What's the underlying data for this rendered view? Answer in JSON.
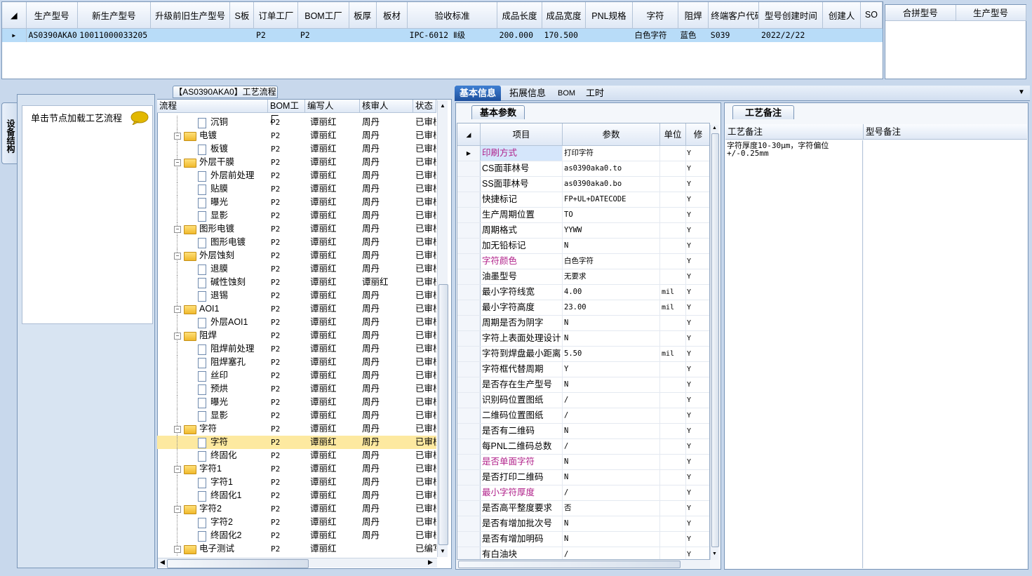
{
  "top_grid": {
    "columns": [
      "生产型号",
      "新生产型号",
      "升级前旧生产型号",
      "S板",
      "订单工厂",
      "BOM工厂",
      "板厚",
      "板材",
      "验收标准",
      "成品长度",
      "成品宽度",
      "PNL规格",
      "字符",
      "阻焊",
      "终端客户代码",
      "型号创建时间",
      "创建人",
      "SO"
    ],
    "rows": [
      [
        "AS0390AKA0",
        "10011000033205",
        "",
        "",
        "P2",
        "P2",
        "",
        "",
        "IPC-6012 Ⅱ级",
        "200.000",
        "170.500",
        "",
        "白色字符",
        "蓝色",
        "S039",
        "2022/2/22",
        "",
        ""
      ]
    ]
  },
  "merge_grid": {
    "columns": [
      "合拼型号",
      "生产型号"
    ]
  },
  "device_panel": {
    "tab_label": "设备结构",
    "hint": "单击节点加载工艺流程"
  },
  "flow": {
    "title": "【AS0390AKA0】工艺流程",
    "columns": [
      "流程",
      "BOM工厂",
      "编写人",
      "核审人",
      "状态"
    ],
    "rows": [
      {
        "name": "沉铜",
        "level": 1,
        "bom": "P2",
        "writer": "谭丽红",
        "reviewer": "周丹",
        "status": "已审核"
      },
      {
        "name": "电镀",
        "level": 0,
        "bom": "P2",
        "writer": "谭丽红",
        "reviewer": "周丹",
        "status": "已审核"
      },
      {
        "name": "板镀",
        "level": 1,
        "bom": "P2",
        "writer": "谭丽红",
        "reviewer": "周丹",
        "status": "已审核"
      },
      {
        "name": "外层干膜",
        "level": 0,
        "bom": "P2",
        "writer": "谭丽红",
        "reviewer": "周丹",
        "status": "已审核"
      },
      {
        "name": "外层前处理",
        "level": 1,
        "bom": "P2",
        "writer": "谭丽红",
        "reviewer": "周丹",
        "status": "已审核"
      },
      {
        "name": "贴膜",
        "level": 1,
        "bom": "P2",
        "writer": "谭丽红",
        "reviewer": "周丹",
        "status": "已审核"
      },
      {
        "name": "曝光",
        "level": 1,
        "bom": "P2",
        "writer": "谭丽红",
        "reviewer": "周丹",
        "status": "已审核"
      },
      {
        "name": "显影",
        "level": 1,
        "bom": "P2",
        "writer": "谭丽红",
        "reviewer": "周丹",
        "status": "已审核"
      },
      {
        "name": "图形电镀",
        "level": 0,
        "bom": "P2",
        "writer": "谭丽红",
        "reviewer": "周丹",
        "status": "已审核"
      },
      {
        "name": "图形电镀",
        "level": 1,
        "bom": "P2",
        "writer": "谭丽红",
        "reviewer": "周丹",
        "status": "已审核"
      },
      {
        "name": "外层蚀刻",
        "level": 0,
        "bom": "P2",
        "writer": "谭丽红",
        "reviewer": "周丹",
        "status": "已审核"
      },
      {
        "name": "退膜",
        "level": 1,
        "bom": "P2",
        "writer": "谭丽红",
        "reviewer": "周丹",
        "status": "已审核"
      },
      {
        "name": "碱性蚀刻",
        "level": 1,
        "bom": "P2",
        "writer": "谭丽红",
        "reviewer": "谭丽红",
        "status": "已审核"
      },
      {
        "name": "退锡",
        "level": 1,
        "bom": "P2",
        "writer": "谭丽红",
        "reviewer": "周丹",
        "status": "已审核"
      },
      {
        "name": "AOI1",
        "level": 0,
        "bom": "P2",
        "writer": "谭丽红",
        "reviewer": "周丹",
        "status": "已审核"
      },
      {
        "name": "外层AOI1",
        "level": 1,
        "bom": "P2",
        "writer": "谭丽红",
        "reviewer": "周丹",
        "status": "已审核"
      },
      {
        "name": "阻焊",
        "level": 0,
        "bom": "P2",
        "writer": "谭丽红",
        "reviewer": "周丹",
        "status": "已审核"
      },
      {
        "name": "阻焊前处理",
        "level": 1,
        "bom": "P2",
        "writer": "谭丽红",
        "reviewer": "周丹",
        "status": "已审核"
      },
      {
        "name": "阻焊塞孔",
        "level": 1,
        "bom": "P2",
        "writer": "谭丽红",
        "reviewer": "周丹",
        "status": "已审核"
      },
      {
        "name": "丝印",
        "level": 1,
        "bom": "P2",
        "writer": "谭丽红",
        "reviewer": "周丹",
        "status": "已审核"
      },
      {
        "name": "预烘",
        "level": 1,
        "bom": "P2",
        "writer": "谭丽红",
        "reviewer": "周丹",
        "status": "已审核"
      },
      {
        "name": "曝光",
        "level": 1,
        "bom": "P2",
        "writer": "谭丽红",
        "reviewer": "周丹",
        "status": "已审核"
      },
      {
        "name": "显影",
        "level": 1,
        "bom": "P2",
        "writer": "谭丽红",
        "reviewer": "周丹",
        "status": "已审核"
      },
      {
        "name": "字符",
        "level": 0,
        "bom": "P2",
        "writer": "谭丽红",
        "reviewer": "周丹",
        "status": "已审核"
      },
      {
        "name": "字符",
        "level": 1,
        "bom": "P2",
        "writer": "谭丽红",
        "reviewer": "周丹",
        "status": "已审核",
        "selected": true
      },
      {
        "name": "终固化",
        "level": 1,
        "bom": "P2",
        "writer": "谭丽红",
        "reviewer": "周丹",
        "status": "已审核"
      },
      {
        "name": "字符1",
        "level": 0,
        "bom": "P2",
        "writer": "谭丽红",
        "reviewer": "周丹",
        "status": "已审核"
      },
      {
        "name": "字符1",
        "level": 1,
        "bom": "P2",
        "writer": "谭丽红",
        "reviewer": "周丹",
        "status": "已审核"
      },
      {
        "name": "终固化1",
        "level": 1,
        "bom": "P2",
        "writer": "谭丽红",
        "reviewer": "周丹",
        "status": "已审核"
      },
      {
        "name": "字符2",
        "level": 0,
        "bom": "P2",
        "writer": "谭丽红",
        "reviewer": "周丹",
        "status": "已审核"
      },
      {
        "name": "字符2",
        "level": 1,
        "bom": "P2",
        "writer": "谭丽红",
        "reviewer": "周丹",
        "status": "已审核"
      },
      {
        "name": "终固化2",
        "level": 1,
        "bom": "P2",
        "writer": "谭丽红",
        "reviewer": "周丹",
        "status": "已审核"
      },
      {
        "name": "电子测试",
        "level": 0,
        "bom": "P2",
        "writer": "谭丽红",
        "reviewer": "",
        "status": "已编写"
      }
    ]
  },
  "right_tabs": [
    "基本信息",
    "拓展信息",
    "BOM",
    "工时"
  ],
  "basic": {
    "title": "基本参数",
    "columns": [
      "项目",
      "参数",
      "单位",
      "修"
    ],
    "rows": [
      {
        "item": "印刷方式",
        "value": "打印字符",
        "unit": "",
        "mod": "Y",
        "hl": true,
        "current": true
      },
      {
        "item": "CS面菲林号",
        "value": "as0390aka0.to",
        "unit": "",
        "mod": "Y"
      },
      {
        "item": "SS面菲林号",
        "value": "as0390aka0.bo",
        "unit": "",
        "mod": "Y"
      },
      {
        "item": "快捷标记",
        "value": "FP+UL+DATECODE",
        "unit": "",
        "mod": "Y"
      },
      {
        "item": "生产周期位置",
        "value": "TO",
        "unit": "",
        "mod": "Y"
      },
      {
        "item": "周期格式",
        "value": "YYWW",
        "unit": "",
        "mod": "Y"
      },
      {
        "item": "加无铅标记",
        "value": "N",
        "unit": "",
        "mod": "Y"
      },
      {
        "item": "字符颜色",
        "value": "白色字符",
        "unit": "",
        "mod": "Y",
        "hl": true
      },
      {
        "item": "油墨型号",
        "value": "无要求",
        "unit": "",
        "mod": "Y"
      },
      {
        "item": "最小字符线宽",
        "value": "4.00",
        "unit": "mil",
        "mod": "Y"
      },
      {
        "item": "最小字符高度",
        "value": "23.00",
        "unit": "mil",
        "mod": "Y"
      },
      {
        "item": "周期是否为阴字",
        "value": "N",
        "unit": "",
        "mod": "Y"
      },
      {
        "item": "字符上表面处理设计",
        "value": "N",
        "unit": "",
        "mod": "Y"
      },
      {
        "item": "字符到焊盘最小距离",
        "value": "5.50",
        "unit": "mil",
        "mod": "Y"
      },
      {
        "item": "字符框代替周期",
        "value": "Y",
        "unit": "",
        "mod": "Y"
      },
      {
        "item": "是否存在生产型号",
        "value": "N",
        "unit": "",
        "mod": "Y"
      },
      {
        "item": "识别码位置图纸",
        "value": "/",
        "unit": "",
        "mod": "Y"
      },
      {
        "item": "二维码位置图纸",
        "value": "/",
        "unit": "",
        "mod": "Y"
      },
      {
        "item": "是否有二维码",
        "value": "N",
        "unit": "",
        "mod": "Y"
      },
      {
        "item": "每PNL二维码总数",
        "value": "/",
        "unit": "",
        "mod": "Y"
      },
      {
        "item": "是否单面字符",
        "value": "N",
        "unit": "",
        "mod": "Y",
        "hl": true
      },
      {
        "item": "是否打印二维码",
        "value": "N",
        "unit": "",
        "mod": "Y"
      },
      {
        "item": "最小字符厚度",
        "value": "/",
        "unit": "",
        "mod": "Y",
        "hl": true
      },
      {
        "item": "是否高平整度要求",
        "value": "否",
        "unit": "",
        "mod": "Y"
      },
      {
        "item": "是否有增加批次号",
        "value": "N",
        "unit": "",
        "mod": "Y"
      },
      {
        "item": "是否有增加明码",
        "value": "N",
        "unit": "",
        "mod": "Y"
      },
      {
        "item": "有白油块",
        "value": "/",
        "unit": "",
        "mod": "Y"
      }
    ]
  },
  "remarks": {
    "title": "工艺备注",
    "columns": [
      "工艺备注",
      "型号备注"
    ],
    "process_note": "字符厚度10-30μm，字符偏位+/-0.25mm",
    "model_note": ""
  },
  "colors": {
    "selection_blue": "#b8dcf8",
    "tree_select": "#fde9a0",
    "highlight_text": "#b0208a",
    "tab_active": "#1d4f9c"
  }
}
